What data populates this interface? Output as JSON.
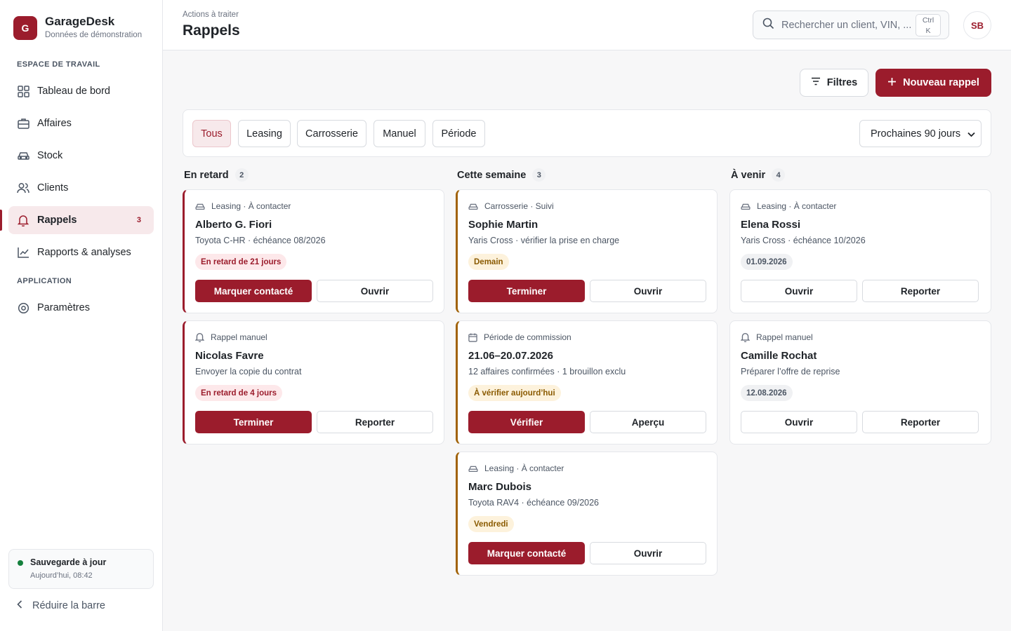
{
  "app": {
    "name": "GarageDesk",
    "subtitle": "Données de démonstration",
    "logo_letter": "G"
  },
  "sidebar": {
    "section_workspace": "ESPACE DE TRAVAIL",
    "section_app": "APPLICATION",
    "items": [
      {
        "label": "Tableau de bord",
        "icon": "grid-icon"
      },
      {
        "label": "Affaires",
        "icon": "briefcase-icon"
      },
      {
        "label": "Stock",
        "icon": "car-icon"
      },
      {
        "label": "Clients",
        "icon": "users-icon"
      },
      {
        "label": "Rappels",
        "icon": "bell-icon",
        "badge": "3",
        "active": true
      },
      {
        "label": "Rapports & analyses",
        "icon": "chart-icon"
      },
      {
        "label": "Paramètres",
        "icon": "gear-icon"
      }
    ],
    "backup": {
      "title": "Sauvegarde à jour",
      "time": "Aujourd’hui, 08:42"
    },
    "collapse_label": "Réduire la barre"
  },
  "header": {
    "breadcrumb": "Actions à traiter",
    "title": "Rappels",
    "search_placeholder": "Rechercher un client, VIN, ...",
    "shortcut_line1": "Ctrl",
    "shortcut_line2": "K",
    "avatar_initials": "SB"
  },
  "actions": {
    "filters": "Filtres",
    "new_reminder": "Nouveau rappel"
  },
  "filters": {
    "chips": [
      "Tous",
      "Leasing",
      "Carrosserie",
      "Manuel",
      "Période"
    ],
    "period_select": "Prochaines 90 jours"
  },
  "columns": [
    {
      "title": "En retard",
      "count": "2",
      "cards": [
        {
          "meta": "Leasing · À contacter",
          "meta_icon": "car-icon",
          "name": "Alberto G. Fiori",
          "sub": "Toyota C-HR · échéance 08/2026",
          "badge": "En retard de 21 jours",
          "primary": "Marquer contacté",
          "secondary": "Ouvrir"
        },
        {
          "meta": "Rappel manuel",
          "meta_icon": "bell-icon",
          "name": "Nicolas Favre",
          "sub": "Envoyer la copie du contrat",
          "badge": "En retard de 4 jours",
          "primary": "Terminer",
          "secondary": "Reporter"
        }
      ]
    },
    {
      "title": "Cette semaine",
      "count": "3",
      "cards": [
        {
          "meta": "Carrosserie · Suivi",
          "meta_icon": "car-icon",
          "name": "Sophie Martin",
          "sub": "Yaris Cross · vérifier la prise en charge",
          "badge": "Demain",
          "primary": "Terminer",
          "secondary": "Ouvrir"
        },
        {
          "meta": "Période de commission",
          "meta_icon": "calendar-icon",
          "name": "21.06–20.07.2026",
          "sub": "12 affaires confirmées · 1 brouillon exclu",
          "badge": "À vérifier aujourd’hui",
          "primary": "Vérifier",
          "secondary": "Aperçu"
        },
        {
          "meta": "Leasing · À contacter",
          "meta_icon": "car-icon",
          "name": "Marc Dubois",
          "sub": "Toyota RAV4 · échéance 09/2026",
          "badge": "Vendredi",
          "primary": "Marquer contacté",
          "secondary": "Ouvrir"
        }
      ]
    },
    {
      "title": "À venir",
      "count": "4",
      "cards": [
        {
          "meta": "Leasing · À contacter",
          "meta_icon": "car-icon",
          "name": "Elena Rossi",
          "sub": "Yaris Cross · échéance 10/2026",
          "badge": "01.09.2026",
          "left_btn": "Ouvrir",
          "right_btn": "Reporter"
        },
        {
          "meta": "Rappel manuel",
          "meta_icon": "bell-icon",
          "name": "Camille Rochat",
          "sub": "Préparer l’offre de reprise",
          "badge": "12.08.2026",
          "left_btn": "Ouvrir",
          "right_btn": "Reporter"
        }
      ]
    }
  ]
}
